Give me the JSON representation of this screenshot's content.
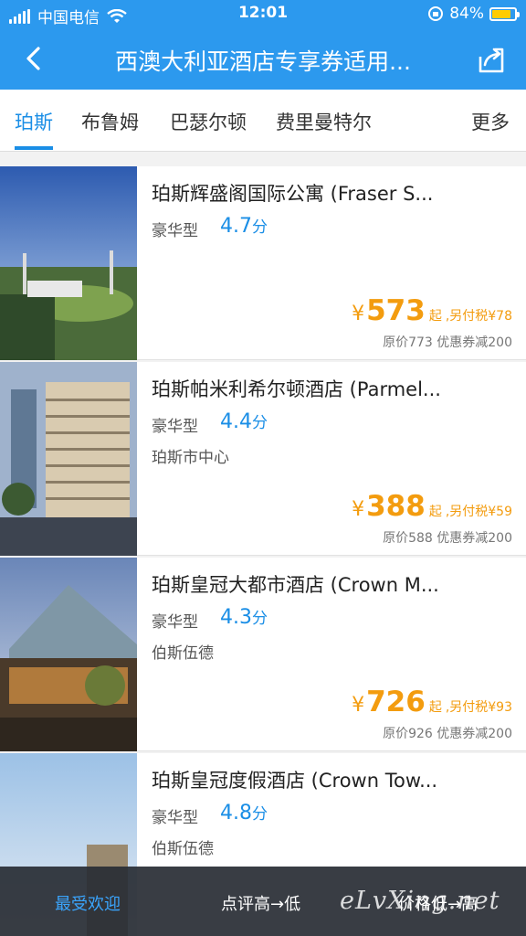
{
  "status_bar": {
    "carrier": "中国电信",
    "time": "12:01",
    "battery": "84%",
    "battery_level": 0.84
  },
  "header": {
    "title": "西澳大利亚酒店专享券适用..."
  },
  "tabs": [
    {
      "label": "珀斯"
    },
    {
      "label": "布鲁姆"
    },
    {
      "label": "巴瑟尔顿"
    },
    {
      "label": "费里曼特尔"
    },
    {
      "label": "更多"
    }
  ],
  "hotels": [
    {
      "name": "珀斯辉盛阁国际公寓 (Fraser S...",
      "type": "豪华型",
      "score": "4.7",
      "score_unit": "分",
      "location": "",
      "currency": "¥",
      "price": "573",
      "from": "起",
      "tax": ",另付税¥78",
      "original": "原价773 优惠券减200"
    },
    {
      "name": "珀斯帕米利希尔顿酒店 (Parmel...",
      "type": "豪华型",
      "score": "4.4",
      "score_unit": "分",
      "location": "珀斯市中心",
      "currency": "¥",
      "price": "388",
      "from": "起",
      "tax": ",另付税¥59",
      "original": "原价588 优惠券减200"
    },
    {
      "name": "珀斯皇冠大都市酒店 (Crown M...",
      "type": "豪华型",
      "score": "4.3",
      "score_unit": "分",
      "location": "伯斯伍德",
      "currency": "¥",
      "price": "726",
      "from": "起",
      "tax": ",另付税¥93",
      "original": "原价926 优惠券减200"
    },
    {
      "name": "珀斯皇冠度假酒店 (Crown Tow...",
      "type": "豪华型",
      "score": "4.8",
      "score_unit": "分",
      "location": "伯斯伍德"
    }
  ],
  "sort_bar": {
    "popular": "最受欢迎",
    "rating": "点评高→低",
    "price": "价格低→高"
  },
  "watermark": "eLvXing.net",
  "colors": {
    "header": "#2c99ee",
    "accent": "#1a8ee6",
    "price": "#f39c0f",
    "battery": "#ffcc00"
  }
}
